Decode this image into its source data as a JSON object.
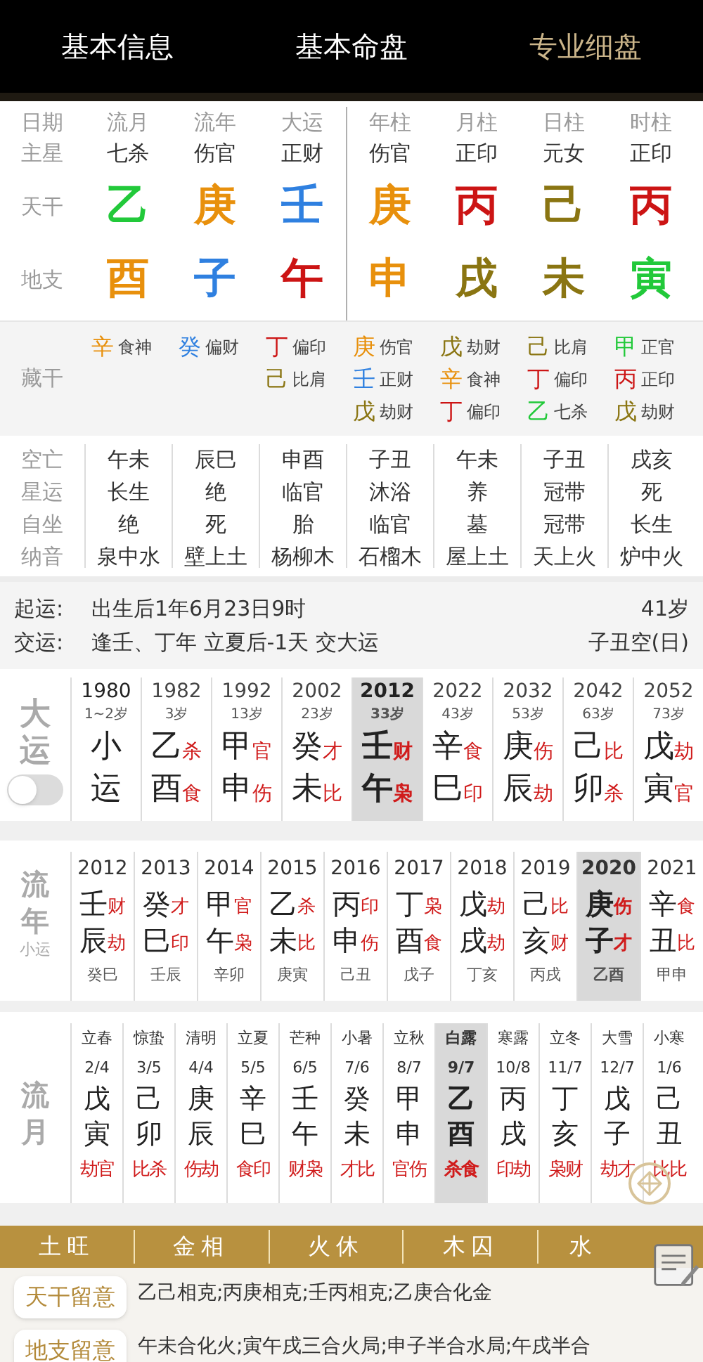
{
  "tabs": [
    {
      "label": "基本信息",
      "selected": false
    },
    {
      "label": "基本命盘",
      "selected": false
    },
    {
      "label": "专业细盘",
      "selected": true
    }
  ],
  "pillars": {
    "row_labels": [
      "日期",
      "主星",
      "天干",
      "地支"
    ],
    "columns": [
      {
        "title": "流月",
        "star": "七杀",
        "stem": {
          "char": "乙",
          "color": "#22c93a"
        },
        "branch": {
          "char": "酉",
          "color": "#e8900c"
        }
      },
      {
        "title": "流年",
        "star": "伤官",
        "stem": {
          "char": "庚",
          "color": "#e8900c"
        },
        "branch": {
          "char": "子",
          "color": "#2f80e0"
        }
      },
      {
        "title": "大运",
        "star": "正财",
        "stem": {
          "char": "壬",
          "color": "#2f80e0"
        },
        "branch": {
          "char": "午",
          "color": "#cc1414"
        }
      },
      {
        "title": "年柱",
        "star": "伤官",
        "stem": {
          "char": "庚",
          "color": "#e8900c"
        },
        "branch": {
          "char": "申",
          "color": "#e8900c"
        }
      },
      {
        "title": "月柱",
        "star": "正印",
        "stem": {
          "char": "丙",
          "color": "#cc1414"
        },
        "branch": {
          "char": "戌",
          "color": "#8a7512"
        }
      },
      {
        "title": "日柱",
        "star": "元女",
        "stem": {
          "char": "己",
          "color": "#8a7512"
        },
        "branch": {
          "char": "未",
          "color": "#8a7512"
        }
      },
      {
        "title": "时柱",
        "star": "正印",
        "stem": {
          "char": "丙",
          "color": "#cc1414"
        },
        "branch": {
          "char": "寅",
          "color": "#22c93a"
        }
      }
    ]
  },
  "hidden_stems": {
    "label": "藏干",
    "columns": [
      [
        {
          "char": "辛",
          "color": "#e8900c",
          "god": "食神"
        }
      ],
      [
        {
          "char": "癸",
          "color": "#2f80e0",
          "god": "偏财"
        }
      ],
      [
        {
          "char": "丁",
          "color": "#cc1414",
          "god": "偏印"
        },
        {
          "char": "己",
          "color": "#8a7512",
          "god": "比肩"
        }
      ],
      [
        {
          "char": "庚",
          "color": "#e8900c",
          "god": "伤官"
        },
        {
          "char": "壬",
          "color": "#2f80e0",
          "god": "正财"
        },
        {
          "char": "戊",
          "color": "#8a7512",
          "god": "劫财"
        }
      ],
      [
        {
          "char": "戊",
          "color": "#8a7512",
          "god": "劫财"
        },
        {
          "char": "辛",
          "color": "#e8900c",
          "god": "食神"
        },
        {
          "char": "丁",
          "color": "#cc1414",
          "god": "偏印"
        }
      ],
      [
        {
          "char": "己",
          "color": "#8a7512",
          "god": "比肩"
        },
        {
          "char": "丁",
          "color": "#cc1414",
          "god": "偏印"
        },
        {
          "char": "乙",
          "color": "#22c93a",
          "god": "七杀"
        }
      ],
      [
        {
          "char": "甲",
          "color": "#22c93a",
          "god": "正官"
        },
        {
          "char": "丙",
          "color": "#cc1414",
          "god": "正印"
        },
        {
          "char": "戊",
          "color": "#8a7512",
          "god": "劫财"
        }
      ]
    ]
  },
  "details": [
    {
      "label": "空亡",
      "values": [
        "午未",
        "辰巳",
        "申酉",
        "子丑",
        "午未",
        "子丑",
        "戌亥"
      ]
    },
    {
      "label": "星运",
      "values": [
        "长生",
        "绝",
        "临官",
        "沐浴",
        "养",
        "冠带",
        "死"
      ]
    },
    {
      "label": "自坐",
      "values": [
        "绝",
        "死",
        "胎",
        "临官",
        "墓",
        "冠带",
        "长生"
      ]
    },
    {
      "label": "纳音",
      "values": [
        "泉中水",
        "壁上土",
        "杨柳木",
        "石榴木",
        "屋上土",
        "天上火",
        "炉中火"
      ]
    }
  ],
  "info": [
    {
      "label": "起运:",
      "text": "出生后1年6月23日9时",
      "right": "41岁"
    },
    {
      "label": "交运:",
      "text": "逢壬、丁年 立夏后-1天 交大运",
      "right": "子丑空(日)"
    }
  ],
  "dayun": {
    "label": "大运",
    "toggle": {
      "on": false
    },
    "columns": [
      {
        "year": "1980",
        "age": "1~2岁",
        "stem": "小",
        "branch": "运",
        "selected": false
      },
      {
        "year": "1982",
        "age": "3岁",
        "stem": "乙",
        "stem_god": "杀",
        "branch": "酉",
        "branch_god": "食",
        "selected": false
      },
      {
        "year": "1992",
        "age": "13岁",
        "stem": "甲",
        "stem_god": "官",
        "branch": "申",
        "branch_god": "伤",
        "selected": false
      },
      {
        "year": "2002",
        "age": "23岁",
        "stem": "癸",
        "stem_god": "才",
        "branch": "未",
        "branch_god": "比",
        "selected": false
      },
      {
        "year": "2012",
        "age": "33岁",
        "stem": "壬",
        "stem_god": "财",
        "branch": "午",
        "branch_god": "枭",
        "selected": true
      },
      {
        "year": "2022",
        "age": "43岁",
        "stem": "辛",
        "stem_god": "食",
        "branch": "巳",
        "branch_god": "印",
        "selected": false
      },
      {
        "year": "2032",
        "age": "53岁",
        "stem": "庚",
        "stem_god": "伤",
        "branch": "辰",
        "branch_god": "劫",
        "selected": false
      },
      {
        "year": "2042",
        "age": "63岁",
        "stem": "己",
        "stem_god": "比",
        "branch": "卯",
        "branch_god": "杀",
        "selected": false
      },
      {
        "year": "2052",
        "age": "73岁",
        "stem": "戊",
        "stem_god": "劫",
        "branch": "寅",
        "branch_god": "官",
        "selected": false
      }
    ]
  },
  "liunian": {
    "label": "流年",
    "sublabel": "小运",
    "columns": [
      {
        "year": "2012",
        "stem": "壬",
        "stem_god": "财",
        "branch": "辰",
        "branch_god": "劫",
        "xiaoyun": "癸巳",
        "selected": false
      },
      {
        "year": "2013",
        "stem": "癸",
        "stem_god": "才",
        "branch": "巳",
        "branch_god": "印",
        "xiaoyun": "壬辰",
        "selected": false
      },
      {
        "year": "2014",
        "stem": "甲",
        "stem_god": "官",
        "branch": "午",
        "branch_god": "枭",
        "xiaoyun": "辛卯",
        "selected": false
      },
      {
        "year": "2015",
        "stem": "乙",
        "stem_god": "杀",
        "branch": "未",
        "branch_god": "比",
        "xiaoyun": "庚寅",
        "selected": false
      },
      {
        "year": "2016",
        "stem": "丙",
        "stem_god": "印",
        "branch": "申",
        "branch_god": "伤",
        "xiaoyun": "己丑",
        "selected": false
      },
      {
        "year": "2017",
        "stem": "丁",
        "stem_god": "枭",
        "branch": "酉",
        "branch_god": "食",
        "xiaoyun": "戊子",
        "selected": false
      },
      {
        "year": "2018",
        "stem": "戊",
        "stem_god": "劫",
        "branch": "戌",
        "branch_god": "劫",
        "xiaoyun": "丁亥",
        "selected": false
      },
      {
        "year": "2019",
        "stem": "己",
        "stem_god": "比",
        "branch": "亥",
        "branch_god": "财",
        "xiaoyun": "丙戌",
        "selected": false
      },
      {
        "year": "2020",
        "stem": "庚",
        "stem_god": "伤",
        "branch": "子",
        "branch_god": "才",
        "xiaoyun": "乙酉",
        "selected": true
      },
      {
        "year": "2021",
        "stem": "辛",
        "stem_god": "食",
        "branch": "丑",
        "branch_god": "比",
        "xiaoyun": "甲申",
        "selected": false
      }
    ]
  },
  "liuyue": {
    "label": "流月",
    "columns": [
      {
        "term": "立春",
        "date": "2/4",
        "stem": "戊",
        "branch": "寅",
        "gods": "劫官",
        "selected": false
      },
      {
        "term": "惊蛰",
        "date": "3/5",
        "stem": "己",
        "branch": "卯",
        "gods": "比杀",
        "selected": false
      },
      {
        "term": "清明",
        "date": "4/4",
        "stem": "庚",
        "branch": "辰",
        "gods": "伤劫",
        "selected": false
      },
      {
        "term": "立夏",
        "date": "5/5",
        "stem": "辛",
        "branch": "巳",
        "gods": "食印",
        "selected": false
      },
      {
        "term": "芒种",
        "date": "6/5",
        "stem": "壬",
        "branch": "午",
        "gods": "财枭",
        "selected": false
      },
      {
        "term": "小暑",
        "date": "7/6",
        "stem": "癸",
        "branch": "未",
        "gods": "才比",
        "selected": false
      },
      {
        "term": "立秋",
        "date": "8/7",
        "stem": "甲",
        "branch": "申",
        "gods": "官伤",
        "selected": false
      },
      {
        "term": "白露",
        "date": "9/7",
        "stem": "乙",
        "branch": "酉",
        "gods": "杀食",
        "selected": true
      },
      {
        "term": "寒露",
        "date": "10/8",
        "stem": "丙",
        "branch": "戌",
        "gods": "印劫",
        "selected": false
      },
      {
        "term": "立冬",
        "date": "11/7",
        "stem": "丁",
        "branch": "亥",
        "gods": "枭财",
        "selected": false
      },
      {
        "term": "大雪",
        "date": "12/7",
        "stem": "戊",
        "branch": "子",
        "gods": "劫才",
        "selected": false
      },
      {
        "term": "小寒",
        "date": "1/6",
        "stem": "己",
        "branch": "丑",
        "gods": "比比",
        "selected": false
      }
    ]
  },
  "strength": [
    "土旺",
    "金相",
    "火休",
    "木囚",
    "水"
  ],
  "notes": [
    {
      "label": "天干留意",
      "text": "乙己相克;丙庚相克;壬丙相克;乙庚合化金"
    },
    {
      "label": "地支留意",
      "text": "午未合化火;寅午戌三合火局;申子半合水局;午戌半合"
    }
  ]
}
